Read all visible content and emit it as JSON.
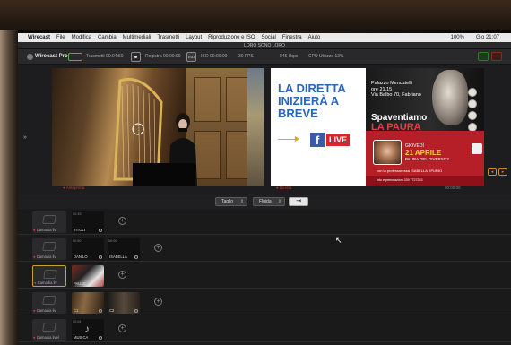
{
  "menubar": {
    "items": [
      "Wirecast",
      "File",
      "Modifica",
      "Cambia",
      "Multimediali",
      "Trasmetti",
      "Layout",
      "Riproduzione e ISO",
      "Social",
      "Finestra",
      "Aiuto"
    ],
    "battery": "100%",
    "clock": "Gio 21:07"
  },
  "window": {
    "title": "LORO SONO LORO"
  },
  "toolbar": {
    "brand": "Wirecast Pro",
    "stream_status": "Trasmetti 00:04:50",
    "record_status": "Registra 00:00:00",
    "iso_label": "ISO",
    "iso_status": "ISO 00:00:00",
    "fps": "30 FPS",
    "bitrate": "845 kbps",
    "cpu": "CPU Utilizzo 13%"
  },
  "preview_live": {
    "headline": "LA DIRETTA INIZIERÀ A BREVE",
    "fb_letter": "f",
    "live_label": "LIVE",
    "poster": {
      "venue": "Palazzo Mencatelli",
      "time": "ore 21,15",
      "address": "Via Balbo 70, Fabriano",
      "title_line1": "Spaventiamo",
      "title_line2": "LA PAURA",
      "day": "GIOVEDÌ",
      "date": "21 APRILE",
      "subtitle": "PAURA DEL DIVERSO?",
      "guest": "con la professoressa ISABELLA SPURIO",
      "info": "Info e prenotazioni 339 7727253",
      "footer": "INGRESSO CONSENTITO SOLO CON GREEN PASS"
    }
  },
  "labels": {
    "preview": "● Anteprima",
    "live": "● Diretta",
    "counter": "00:00:00"
  },
  "controls": {
    "transition_1": "Taglio",
    "transition_2": "Fluida",
    "go": "⇥"
  },
  "layers": [
    {
      "name": "Camadia liv",
      "shots": [
        {
          "tc": "00:33",
          "label": "TITOLI"
        }
      ]
    },
    {
      "name": "Camadia liv",
      "shots": [
        {
          "tc": "00:50",
          "label": "DANILO"
        },
        {
          "tc": "00:00",
          "label": "ISABELLA"
        }
      ]
    },
    {
      "name": "Camadia liv",
      "shots": [
        {
          "tc": "",
          "label": "PAUSE"
        }
      ]
    },
    {
      "name": "Camadia liv",
      "shots": [
        {
          "tc": "",
          "label": "C1"
        },
        {
          "tc": "",
          "label": "C2"
        }
      ]
    },
    {
      "name": "Camadia livel",
      "shots": [
        {
          "tc": "00:04",
          "label": "MUSICA"
        }
      ]
    }
  ],
  "colors": {
    "accent_red": "#d63b2c",
    "selected": "#c8a12c",
    "fb_blue": "#3b5ba8",
    "brand_blue": "#2c66b8"
  }
}
